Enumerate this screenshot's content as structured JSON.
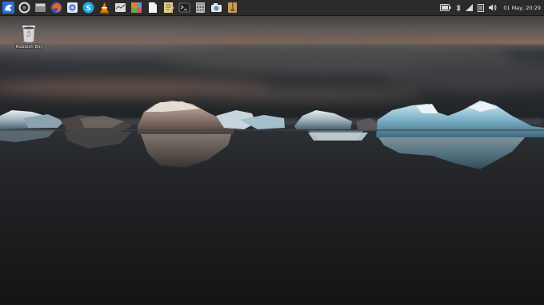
{
  "taskbar": {
    "launchers": [
      {
        "name": "whisker-menu-icon",
        "color": "#2f6fd6"
      },
      {
        "name": "screenshot-tool-icon",
        "color": "#333333"
      },
      {
        "name": "file-manager-icon",
        "color": "#8a8a8a"
      },
      {
        "name": "firefox-icon",
        "color": "#e0662a"
      },
      {
        "name": "settings-manager-icon",
        "color": "#4a7fc1"
      },
      {
        "name": "skype-icon",
        "color": "#25a4e0"
      },
      {
        "name": "vlc-icon",
        "color": "#f08a00"
      },
      {
        "name": "task-manager-icon",
        "color": "#9a9a9a"
      },
      {
        "name": "image-viewer-icon",
        "color": "#d18b2c"
      },
      {
        "name": "text-document-icon",
        "color": "#f2f2f2"
      },
      {
        "name": "text-editor-icon",
        "color": "#e8d28a"
      },
      {
        "name": "terminal-icon",
        "color": "#202020"
      },
      {
        "name": "calculator-icon",
        "color": "#bdbdbd"
      },
      {
        "name": "screenshooter-icon",
        "color": "#5d8fc7"
      },
      {
        "name": "archive-manager-icon",
        "color": "#c79b5a"
      }
    ],
    "tray": {
      "battery_icon": "battery-icon",
      "bluetooth_icon": "bluetooth-icon",
      "network_icon": "network-signal-icon",
      "notes_icon": "notes-icon",
      "volume_icon": "volume-icon",
      "clock": "01 May, 20:29"
    }
  },
  "desktop": {
    "icons": [
      {
        "name": "rubbish-bin-icon",
        "label": "Rubbish Bin"
      }
    ]
  }
}
